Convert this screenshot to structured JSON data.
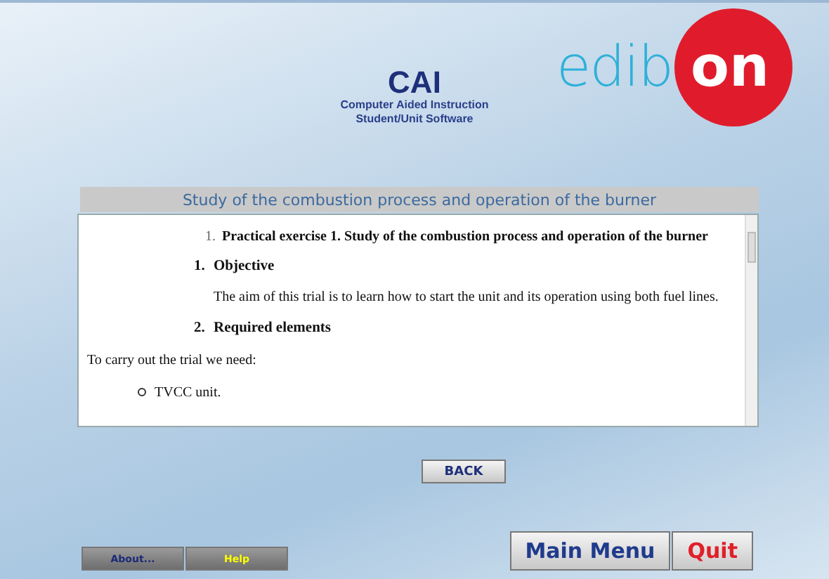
{
  "header": {
    "title": "CAI",
    "subtitle_lines": [
      "Computer Aided Instruction",
      "Student/Unit Software"
    ]
  },
  "logo": {
    "plain_part": "edib",
    "circle_part": "on"
  },
  "panel": {
    "title": "Study of the combustion process and operation of the burner",
    "content": [
      {
        "kind": "heading1",
        "number": "1.",
        "text": "Practical exercise 1. Study of the combustion process and operation of the burner"
      },
      {
        "kind": "heading2",
        "number": "1.",
        "text": "Objective"
      },
      {
        "kind": "indented",
        "text": "The aim of this trial is to learn how to start the unit and its operation using both fuel lines."
      },
      {
        "kind": "heading2",
        "number": "2.",
        "text": "Required elements"
      },
      {
        "kind": "paragraph",
        "text": "To carry out the trial we need:"
      },
      {
        "kind": "bullet",
        "text": "TVCC unit."
      }
    ]
  },
  "back_button": "BACK",
  "footer_buttons": [
    {
      "label": "About...",
      "kind": "small"
    },
    {
      "label": "Help",
      "kind": "small"
    },
    {
      "label": "Main Menu",
      "kind": "large"
    },
    {
      "label": "Quit",
      "kind": "large"
    }
  ]
}
